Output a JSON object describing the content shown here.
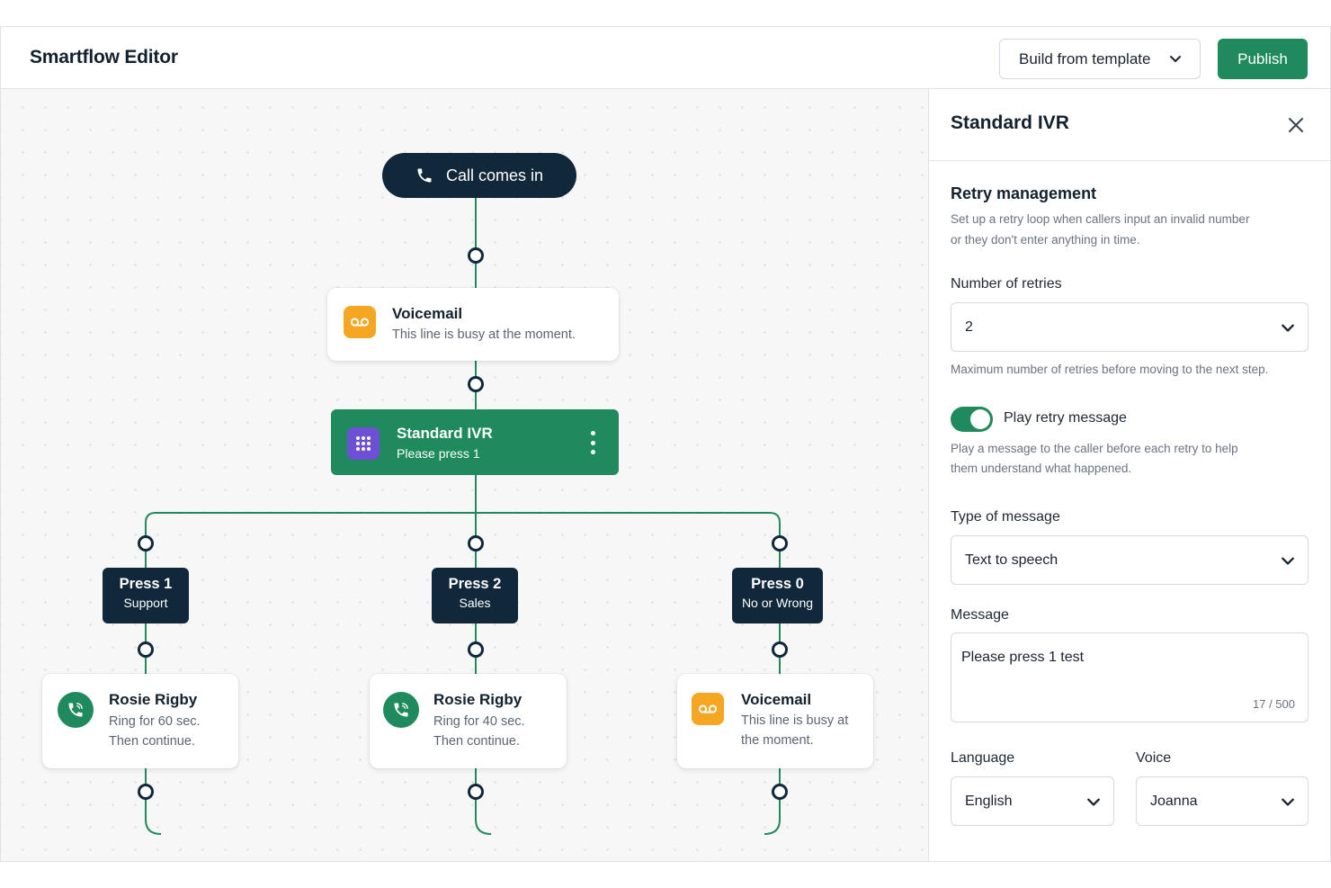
{
  "app": {
    "title": "Smartflow Editor"
  },
  "header": {
    "template_label": "Build from template",
    "publish_label": "Publish"
  },
  "flow": {
    "start": {
      "label": "Call comes in"
    },
    "voicemail": {
      "title": "Voicemail",
      "subtitle": "This line is busy at the moment."
    },
    "ivr": {
      "title": "Standard IVR",
      "subtitle": "Please press 1"
    },
    "options": [
      {
        "title": "Press 1",
        "subtitle": "Support"
      },
      {
        "title": "Press 2",
        "subtitle": "Sales"
      },
      {
        "title": "Press 0",
        "subtitle": "No or Wrong"
      }
    ],
    "destinations": [
      {
        "title": "Rosie Rigby",
        "line1": "Ring for 60 sec.",
        "line2": "Then continue."
      },
      {
        "title": "Rosie Rigby",
        "line1": "Ring for 40 sec.",
        "line2": "Then continue."
      },
      {
        "title": "Voicemail",
        "line1": "This line is busy at",
        "line2": "the moment."
      }
    ]
  },
  "panel": {
    "title": "Standard IVR",
    "section_title": "Retry management",
    "section_help_1": "Set up a retry loop when callers input an invalid number",
    "section_help_2": "or they don't enter anything in time.",
    "retries_label": "Number of retries",
    "retries_value": "2",
    "retries_help": "Maximum number of retries before moving to the next step.",
    "toggle_label": "Play retry message",
    "toggle_on": true,
    "toggle_help_1": "Play a message to the caller before each retry to help",
    "toggle_help_2": "them understand what happened.",
    "type_label": "Type of message",
    "type_value": "Text to speech",
    "message_label": "Message",
    "message_value": "Please press 1 test",
    "message_count": "17 / 500",
    "language_label": "Language",
    "language_value": "English",
    "voice_label": "Voice",
    "voice_value": "Joanna"
  },
  "colors": {
    "brand_green": "#1f8a5b",
    "navy": "#11283a",
    "voicemail_orange": "#f5a623",
    "ivr_purple": "#6f4fd6",
    "connector": "#1f8a5b"
  },
  "icons": {
    "start": "phone-icon",
    "voicemail": "voicemail-icon",
    "ivr": "keypad-icon",
    "agent": "phone-call-icon",
    "menu": "kebab-icon",
    "close": "close-icon",
    "dropdown": "chevron-down-icon"
  }
}
